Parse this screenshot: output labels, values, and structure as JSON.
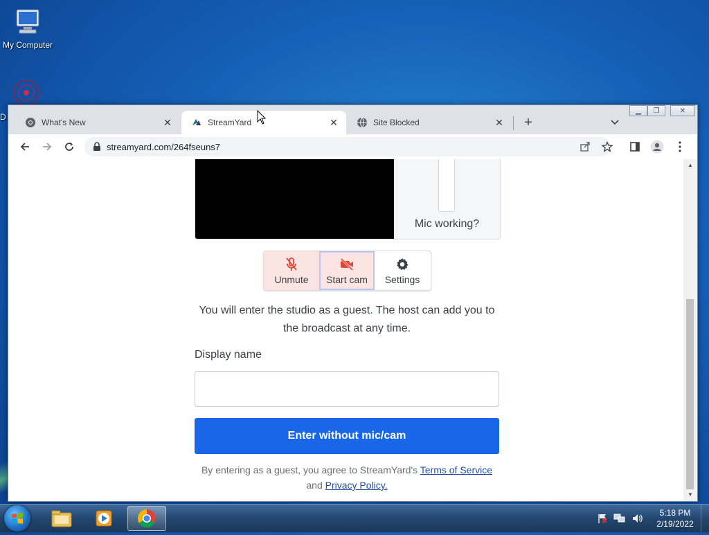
{
  "desktop": {
    "icons": [
      {
        "label": "My Computer",
        "icon": "computer-icon"
      },
      {
        "label": "D",
        "icon": "network-ball-icon"
      }
    ]
  },
  "browser": {
    "tabs": [
      {
        "title": "What's New",
        "icon": "chrome-icon",
        "active": false
      },
      {
        "title": "StreamYard",
        "icon": "streamyard-icon",
        "active": true
      },
      {
        "title": "Site Blocked",
        "icon": "globe-icon",
        "active": false
      }
    ],
    "url": "streamyard.com/264fseuns7"
  },
  "page": {
    "mic_check_label": "Mic working?",
    "controls": [
      {
        "label": "Unmute",
        "icon": "mic-off-icon"
      },
      {
        "label": "Start cam",
        "icon": "camera-off-icon"
      },
      {
        "label": "Settings",
        "icon": "gear-icon"
      }
    ],
    "guest_message": "You will enter the studio as a guest. The host can add you to the broadcast at any time.",
    "display_name_label": "Display name",
    "display_name_value": "",
    "enter_button": "Enter without mic/cam",
    "terms_prefix": "By entering as a guest, you agree to StreamYard's",
    "terms_link": "Terms of Service",
    "terms_and": "and",
    "privacy_link": "Privacy Policy."
  },
  "taskbar": {
    "clock_time": "5:18 PM",
    "clock_date": "2/19/2022"
  },
  "colors": {
    "accent_blue": "#1a66e8",
    "muted_red": "#e0463a",
    "muted_bg": "#fbe4e1"
  }
}
